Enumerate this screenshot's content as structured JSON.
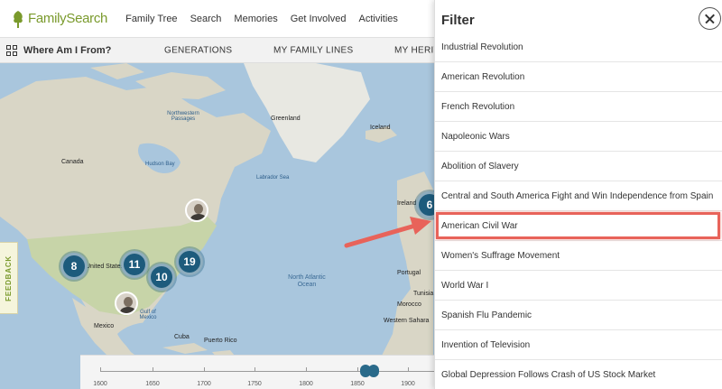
{
  "nav": {
    "logo": "FamilySearch",
    "items": [
      "Family Tree",
      "Search",
      "Memories",
      "Get Involved",
      "Activities"
    ]
  },
  "subbar": {
    "title": "Where Am I From?",
    "tabs": [
      "GENERATIONS",
      "MY FAMILY LINES",
      "MY HERITA"
    ]
  },
  "map": {
    "labels": {
      "greenland": "Greenland",
      "canada": "Canada",
      "united_states": "United States",
      "mexico": "Mexico",
      "cuba": "Cuba",
      "puerto_rico": "Puerto Rico",
      "gulf_of_mexico": "Gulf of Mexico",
      "hudson_bay": "Hudson Bay",
      "labrador_sea": "Labrador Sea",
      "northwestern_passages": "Northwestern Passages",
      "north_atlantic_ocean": "North Atlantic Ocean",
      "iceland": "Iceland",
      "ireland": "Ireland",
      "portugal": "Portugal",
      "morocco": "Morocco",
      "western_sahara": "Western Sahara",
      "tunisia": "Tunisia"
    },
    "clusters": [
      "8",
      "11",
      "10",
      "19",
      "6"
    ],
    "feedback": "FEEDBACK"
  },
  "timeline": {
    "ticks": [
      "1600",
      "1650",
      "1700",
      "1750",
      "1800",
      "1850",
      "1900"
    ]
  },
  "filter": {
    "title": "Filter",
    "items": [
      "Industrial Revolution",
      "American Revolution",
      "French Revolution",
      "Napoleonic Wars",
      "Abolition of Slavery",
      "Central and South America Fight and Win Independence from Spain",
      "American Civil War",
      "Women's Suffrage Movement",
      "World War I",
      "Spanish Flu Pandemic",
      "Invention of Television",
      "Global Depression Follows Crash of US Stock Market"
    ],
    "highlighted_index": 6
  },
  "colors": {
    "brand_green": "#7a9a2c",
    "cluster": "#1d5b7c",
    "ocean": "#a9c6dd",
    "highlight": "#e8635a"
  }
}
